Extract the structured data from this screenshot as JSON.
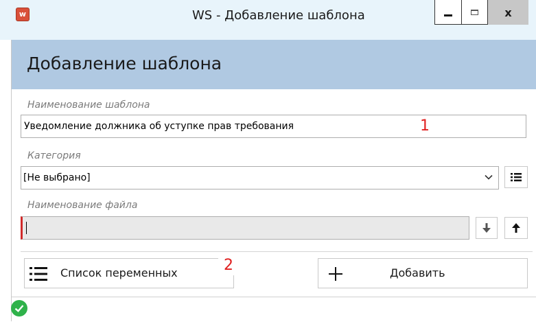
{
  "window": {
    "title": "WS - Добавление шаблона",
    "app_icon_letter": "w",
    "close_glyph": "x"
  },
  "header": {
    "title": "Добавление шаблона"
  },
  "form": {
    "template_name": {
      "label": "Наименование шаблона",
      "value": "Уведомление должника об уступке прав требования"
    },
    "category": {
      "label": "Категория",
      "selected": "[Не выбрано]"
    },
    "file_name": {
      "label": "Наименование файла",
      "value": ""
    }
  },
  "actions": {
    "variables_list_label": "Список переменных",
    "add_label": "Добавить"
  },
  "annotations": {
    "marker_1": "1",
    "marker_2": "2"
  },
  "status": {
    "state": "ok",
    "color": "#2fb24a"
  },
  "colors": {
    "header_band": "#b0c9e2",
    "titlebar": "#e8f4fb",
    "required_marker": "#d12a2a",
    "annotation": "#e02020"
  }
}
